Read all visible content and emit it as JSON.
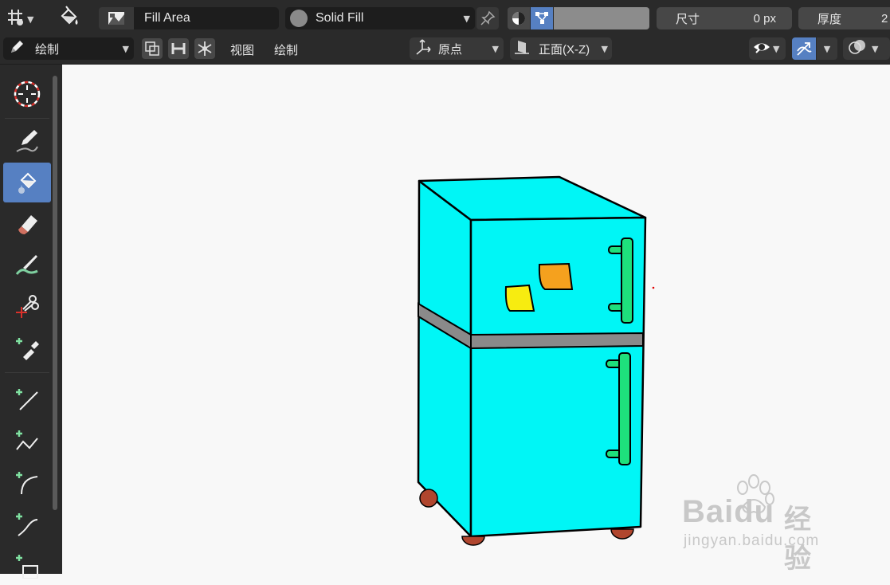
{
  "header": {
    "mode_icon": "draw-mode-icon",
    "tool_icon": "fill-bucket-icon",
    "material_icon": "material-swatch-icon",
    "material_name": "Fill Area",
    "fill_style": "Solid Fill",
    "pin_icon": "pin-icon",
    "size_label": "尺寸",
    "size_value": "0 px",
    "thickness_label": "厚度",
    "thickness_value": "2"
  },
  "subheader": {
    "mode_label": "绘制",
    "menu_view": "视图",
    "menu_draw": "绘制",
    "pivot_label": "原点",
    "view_label": "正面(X-Z)"
  },
  "toolbar": {
    "tools": [
      "cursor",
      "draw",
      "fill",
      "erase",
      "tint",
      "cutter",
      "eyedropper",
      "line",
      "polyline",
      "arc",
      "curve",
      "box"
    ],
    "active_tool": "fill"
  },
  "watermark": {
    "brand": "Baidu",
    "brand_cn": "经验",
    "url": "jingyan.baidu.com"
  },
  "colors": {
    "ui_dark": "#2a2a2a",
    "accent": "#5680c2",
    "fridge_body": "#00f8f8",
    "handle": "#1ee07c",
    "band": "#8a8a8a",
    "note_orange": "#f5a11e",
    "note_yellow": "#f7ec10",
    "wheel": "#b0462e"
  }
}
